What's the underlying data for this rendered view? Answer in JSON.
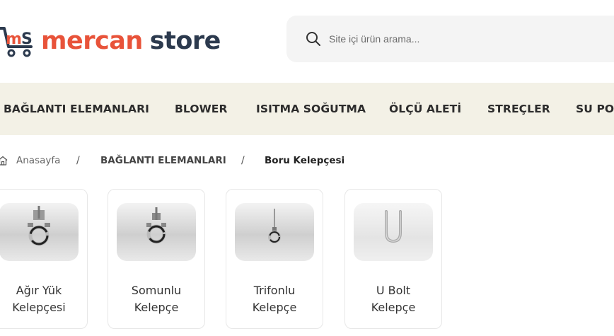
{
  "brand": {
    "word1": "mercan",
    "word2": "store",
    "colors": {
      "accent": "#e8533a",
      "dark": "#2c3a4e"
    }
  },
  "search": {
    "placeholder": "Site içi ürün arama..."
  },
  "nav": {
    "items": [
      "BAĞLANTI ELEMANLARI",
      "BLOWER",
      "ISITMA SOĞUTMA",
      "ÖLÇÜ ALETİ",
      "STREÇLER",
      "SU PO"
    ]
  },
  "breadcrumb": {
    "home": "Anasayfa",
    "separator": "/",
    "category": "BAĞLANTI ELEMANLARI",
    "current": "Boru Kelepçesi"
  },
  "categories": [
    {
      "line1": "Ağır Yük",
      "line2": "Kelepçesi",
      "icon": "pipe-clamp-heavy"
    },
    {
      "line1": "Somunlu",
      "line2": "Kelepçe",
      "icon": "pipe-clamp-nut"
    },
    {
      "line1": "Trifonlu",
      "line2": "Kelepçe",
      "icon": "pipe-clamp-rod"
    },
    {
      "line1": "U Bolt",
      "line2": "Kelepçe",
      "icon": "u-bolt"
    }
  ]
}
